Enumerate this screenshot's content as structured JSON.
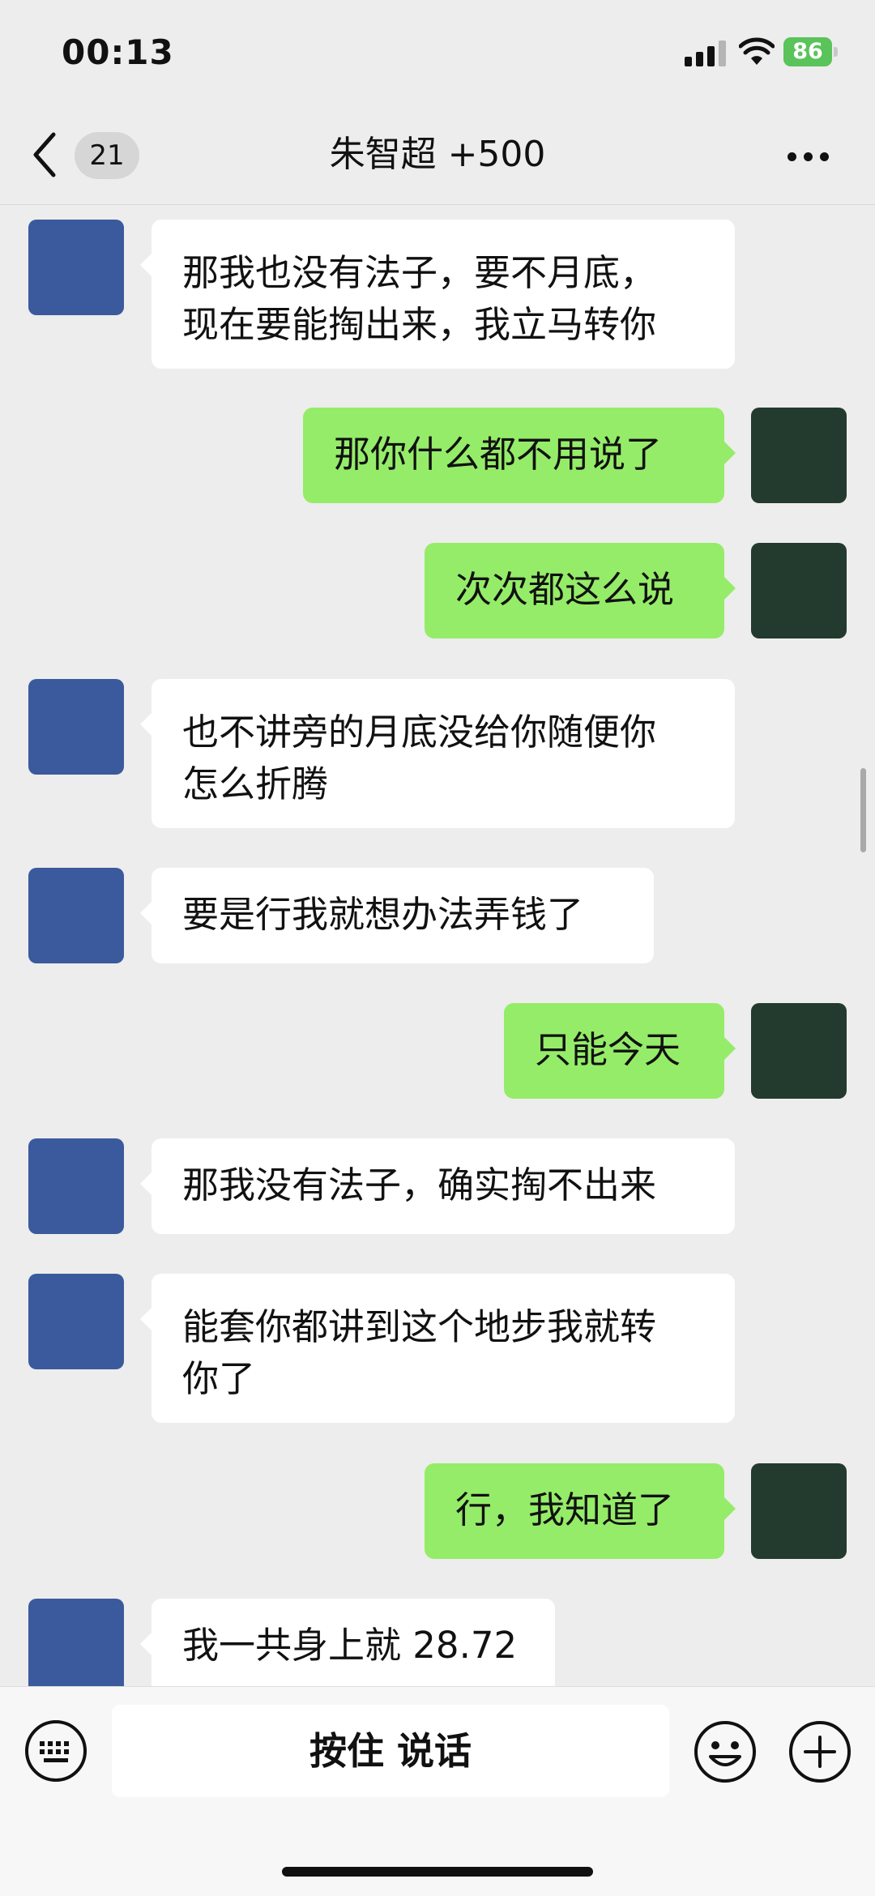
{
  "status_bar": {
    "time": "00:13",
    "battery": "86"
  },
  "header": {
    "back_badge": "21",
    "title": "朱智超 +500"
  },
  "messages": [
    {
      "side": "in",
      "text": "那我也没有法子，要不月底，\n现在要能掏出来，我立马转你"
    },
    {
      "side": "out",
      "text": "那你什么都不用说了"
    },
    {
      "side": "out",
      "text": "次次都这么说"
    },
    {
      "side": "in",
      "text": "也不讲旁的月底没给你随便你\n怎么折腾"
    },
    {
      "side": "in",
      "text": "要是行我就想办法弄钱了"
    },
    {
      "side": "out",
      "text": "只能今天"
    },
    {
      "side": "in",
      "text": "那我没有法子，确实掏不出来"
    },
    {
      "side": "in",
      "text": "能套你都讲到这个地步我就转\n你了"
    },
    {
      "side": "out",
      "text": "行，我知道了"
    },
    {
      "side": "in",
      "text": "我一共身上就 28.72"
    }
  ],
  "input_bar": {
    "voice_label": "按住 说话"
  },
  "colors": {
    "background": "#ededed",
    "bubble_out": "#95ec69",
    "bubble_in": "#ffffff",
    "battery": "#5ac35a"
  },
  "icons": [
    "back-icon",
    "more-icon",
    "keyboard-icon",
    "emoji-icon",
    "plus-icon",
    "signal-icon",
    "wifi-icon",
    "battery-icon"
  ]
}
